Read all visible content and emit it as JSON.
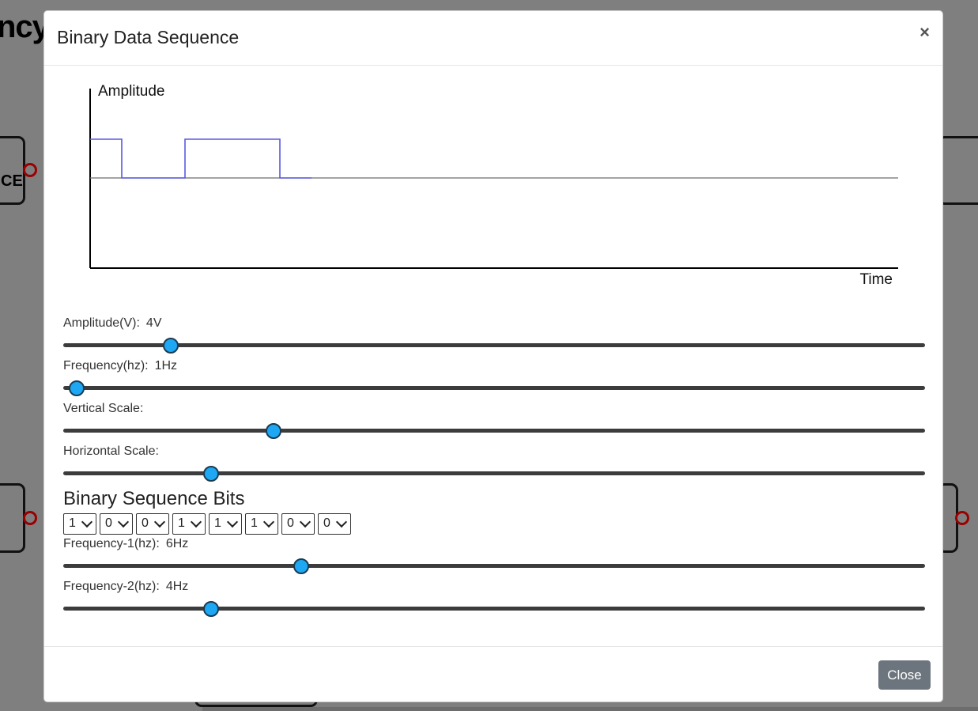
{
  "background": {
    "title_fragment": "ncy",
    "block_label": "CE"
  },
  "modal": {
    "title": "Binary Data Sequence",
    "close_symbol": "×",
    "footer_close_label": "Close"
  },
  "chart_data": {
    "type": "line",
    "ylabel": "Amplitude",
    "xlabel": "Time",
    "bits_plotted": [
      1,
      0,
      0,
      1,
      1,
      1,
      0
    ],
    "line_color": "#5a5ae0",
    "axis_color": "#000000",
    "baseline_color": "#6e6e6e"
  },
  "controls": {
    "amplitude": {
      "label": "Amplitude(V):",
      "value": "4V",
      "position": 0.116
    },
    "frequency": {
      "label": "Frequency(hz):",
      "value": "1Hz",
      "position": 0.006
    },
    "vertical_scale": {
      "label": "Vertical Scale:",
      "value": "",
      "position": 0.235
    },
    "horizontal_scale": {
      "label": "Horizontal Scale:",
      "value": "",
      "position": 0.162
    },
    "bits_section_title": "Binary Sequence Bits",
    "bits": [
      "1",
      "0",
      "0",
      "1",
      "1",
      "1",
      "0",
      "0"
    ],
    "frequency_1": {
      "label": "Frequency-1(hz):",
      "value": "6Hz",
      "position": 0.267
    },
    "frequency_2": {
      "label": "Frequency-2(hz):",
      "value": "4Hz",
      "position": 0.162
    }
  },
  "colors": {
    "slider_thumb": "#1ea7f2",
    "close_button": "#6c757d"
  }
}
